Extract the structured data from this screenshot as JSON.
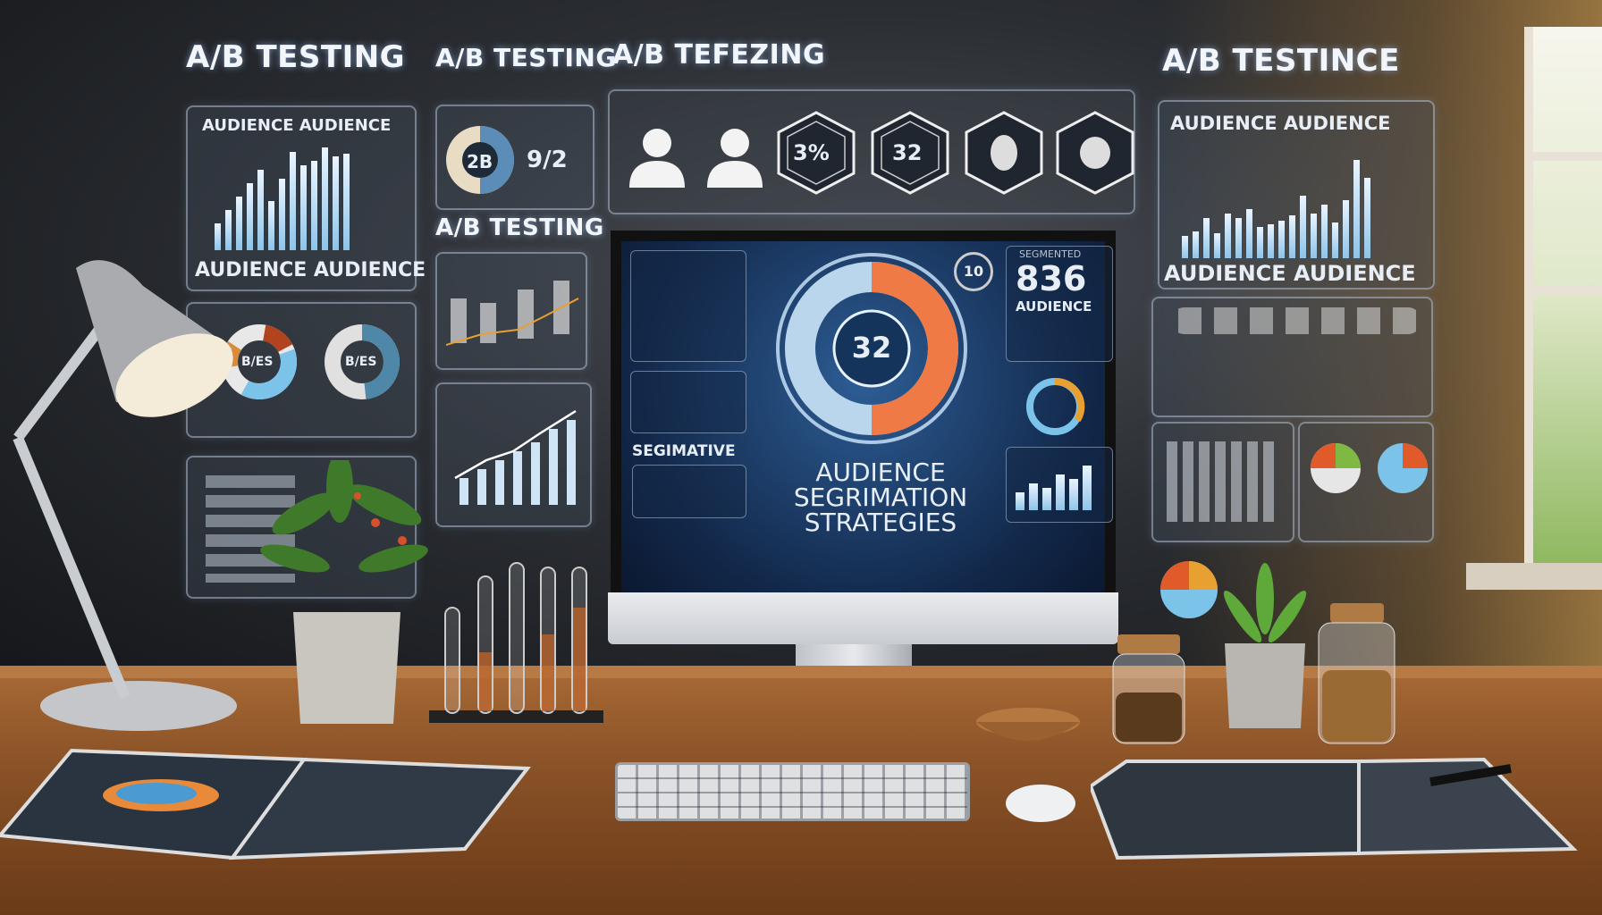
{
  "titles": {
    "col1": "A/B TESTING",
    "col2": "A/B TESTING",
    "col2_mid": "A/B TESTING",
    "col3": "A/B TEFEZING",
    "right": "A/B TESTINCE"
  },
  "panels": {
    "left_chart_heading": "AUDIENCE AUDIENCE",
    "left_chart_footer": "AUDIENCE AUDIENCE",
    "left_donut_1": "B/ES",
    "left_donut_2": "B/ES",
    "pie_label": "2B",
    "ratio_label": "9/2",
    "hex_1": "3%",
    "hex_2": "32",
    "right_chart_heading": "AUDIENCE AUDIENCE",
    "right_chart_footer": "AUDIENCE AUDIENCE"
  },
  "monitor": {
    "center_value": "32",
    "badge_value": "10",
    "side_header": "SEGMENTED",
    "side_value": "836",
    "side_label": "AUDIENCE",
    "left_label": "SEGIMATIVE",
    "headline_1": "AUDIENCE",
    "headline_2": "SEGRIMATION",
    "headline_3": "STRATEGIES"
  },
  "colors": {
    "accent_orange": "#f07a45",
    "accent_blue": "#7cc3ea",
    "wood": "#8a5227"
  }
}
